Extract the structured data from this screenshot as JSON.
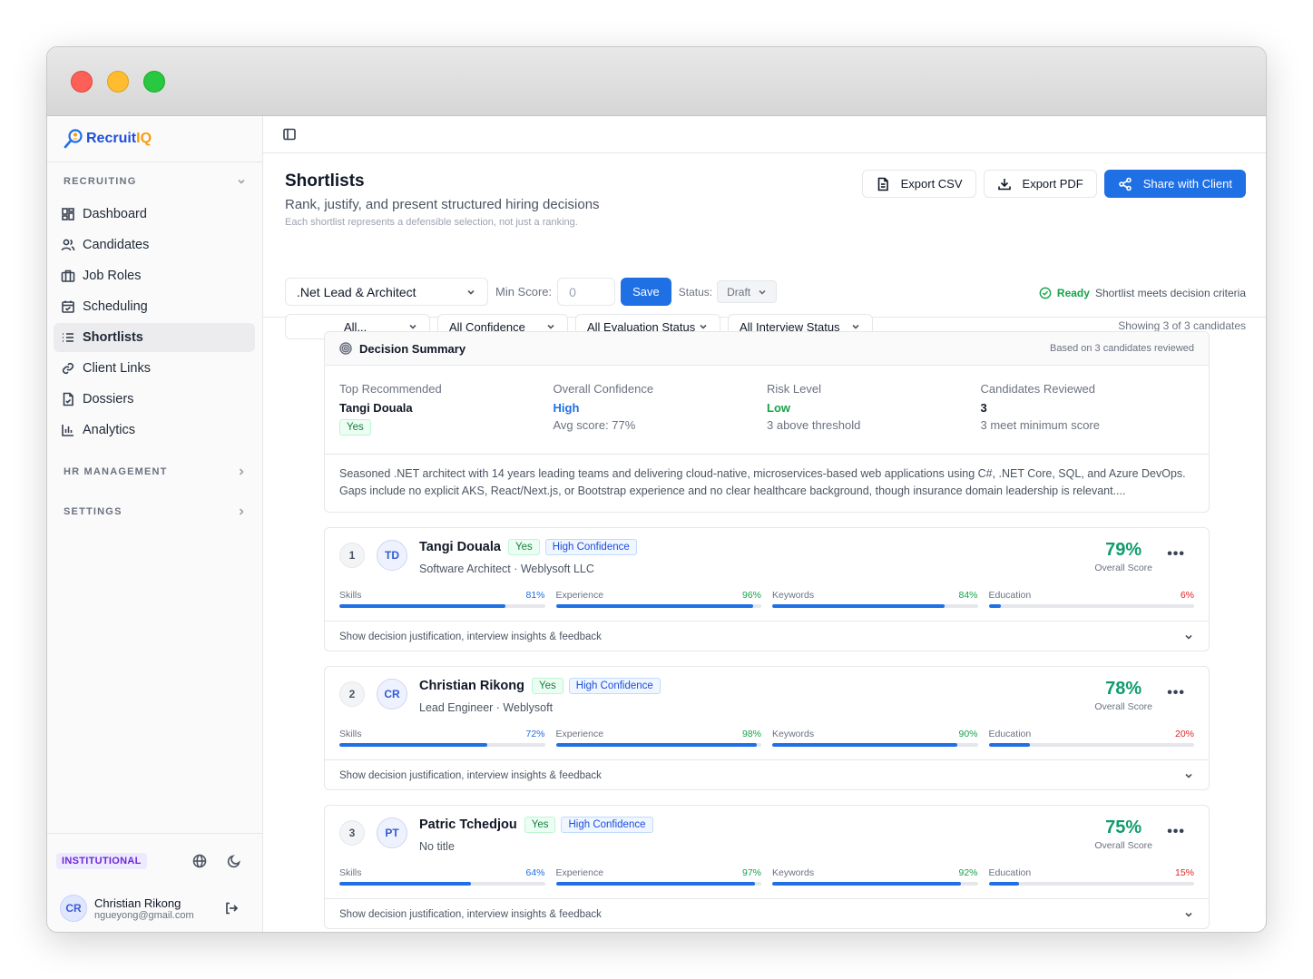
{
  "brand": {
    "name_main": "Recruit",
    "name_accent": "IQ"
  },
  "sidebar": {
    "sections": [
      {
        "title": "RECRUITING",
        "items": [
          {
            "label": "Dashboard",
            "icon": "dashboard-icon"
          },
          {
            "label": "Candidates",
            "icon": "users-icon"
          },
          {
            "label": "Job Roles",
            "icon": "briefcase-icon"
          },
          {
            "label": "Scheduling",
            "icon": "calendar-icon"
          },
          {
            "label": "Shortlists",
            "icon": "list-icon",
            "active": true
          },
          {
            "label": "Client Links",
            "icon": "link-icon"
          },
          {
            "label": "Dossiers",
            "icon": "file-icon"
          },
          {
            "label": "Analytics",
            "icon": "chart-icon"
          }
        ]
      },
      {
        "title": "HR MANAGEMENT"
      },
      {
        "title": "SETTINGS"
      }
    ],
    "plan_badge": "INSTITUTIONAL",
    "user": {
      "initials": "CR",
      "name": "Christian Rikong",
      "email": "ngueyong@gmail.com"
    }
  },
  "header": {
    "title": "Shortlists",
    "subtitle": "Rank, justify, and present structured hiring decisions",
    "note": "Each shortlist represents a defensible selection, not just a ranking.",
    "actions": {
      "export_csv": "Export CSV",
      "export_pdf": "Export PDF",
      "share": "Share with Client"
    }
  },
  "filters": {
    "role": ".Net Lead & Architect",
    "min_score_label": "Min Score:",
    "min_score_value": "0",
    "save_label": "Save",
    "status_label": "Status:",
    "status_value": "Draft",
    "all": "All...",
    "confidence": "All Confidence",
    "evaluation": "All Evaluation Status",
    "interview": "All Interview Status",
    "ready_label": "Ready",
    "ready_text": "Shortlist meets decision criteria",
    "showing": "Showing 3 of 3 candidates"
  },
  "summary": {
    "title": "Decision Summary",
    "note": "Based on 3 candidates reviewed",
    "top_label": "Top Recommended",
    "top_value": "Tangi Douala",
    "top_badge": "Yes",
    "confidence_label": "Overall Confidence",
    "confidence_value": "High",
    "confidence_sub": "Avg score: 77%",
    "risk_label": "Risk Level",
    "risk_value": "Low",
    "risk_sub": "3 above threshold",
    "reviewed_label": "Candidates Reviewed",
    "reviewed_value": "3",
    "reviewed_sub": "3 meet minimum score",
    "text": "Seasoned .NET architect with 14 years leading teams and delivering cloud-native, microservices-based web applications using C#, .NET Core, SQL, and Azure DevOps. Gaps include no explicit AKS, React/Next.js, or Bootstrap experience and no clear healthcare background, though insurance domain leadership is relevant...."
  },
  "labels": {
    "overall_score": "Overall Score",
    "expand": "Show decision justification, interview insights & feedback",
    "skills": "Skills",
    "experience": "Experience",
    "keywords": "Keywords",
    "education": "Education"
  },
  "candidates": [
    {
      "rank": "1",
      "initials": "TD",
      "name": "Tangi Douala",
      "decision": "Yes",
      "confidence": "High Confidence",
      "title": "Software Architect · Weblysoft LLC",
      "score": "79%",
      "skills": "81%",
      "experience": "96%",
      "keywords": "84%",
      "education": "6%",
      "skills_pct": 81,
      "experience_pct": 96,
      "keywords_pct": 84,
      "education_pct": 6
    },
    {
      "rank": "2",
      "initials": "CR",
      "name": "Christian Rikong",
      "decision": "Yes",
      "confidence": "High Confidence",
      "title": "Lead Engineer · Weblysoft",
      "score": "78%",
      "skills": "72%",
      "experience": "98%",
      "keywords": "90%",
      "education": "20%",
      "skills_pct": 72,
      "experience_pct": 98,
      "keywords_pct": 90,
      "education_pct": 20
    },
    {
      "rank": "3",
      "initials": "PT",
      "name": "Patric Tchedjou",
      "decision": "Yes",
      "confidence": "High Confidence",
      "title": "No title",
      "score": "75%",
      "skills": "64%",
      "experience": "97%",
      "keywords": "92%",
      "education": "15%",
      "skills_pct": 64,
      "experience_pct": 97,
      "keywords_pct": 92,
      "education_pct": 15
    }
  ],
  "colors": {
    "primary": "#1f6fe5",
    "success": "#16a34a",
    "danger": "#dc2626",
    "score": "#0f9d6b"
  }
}
